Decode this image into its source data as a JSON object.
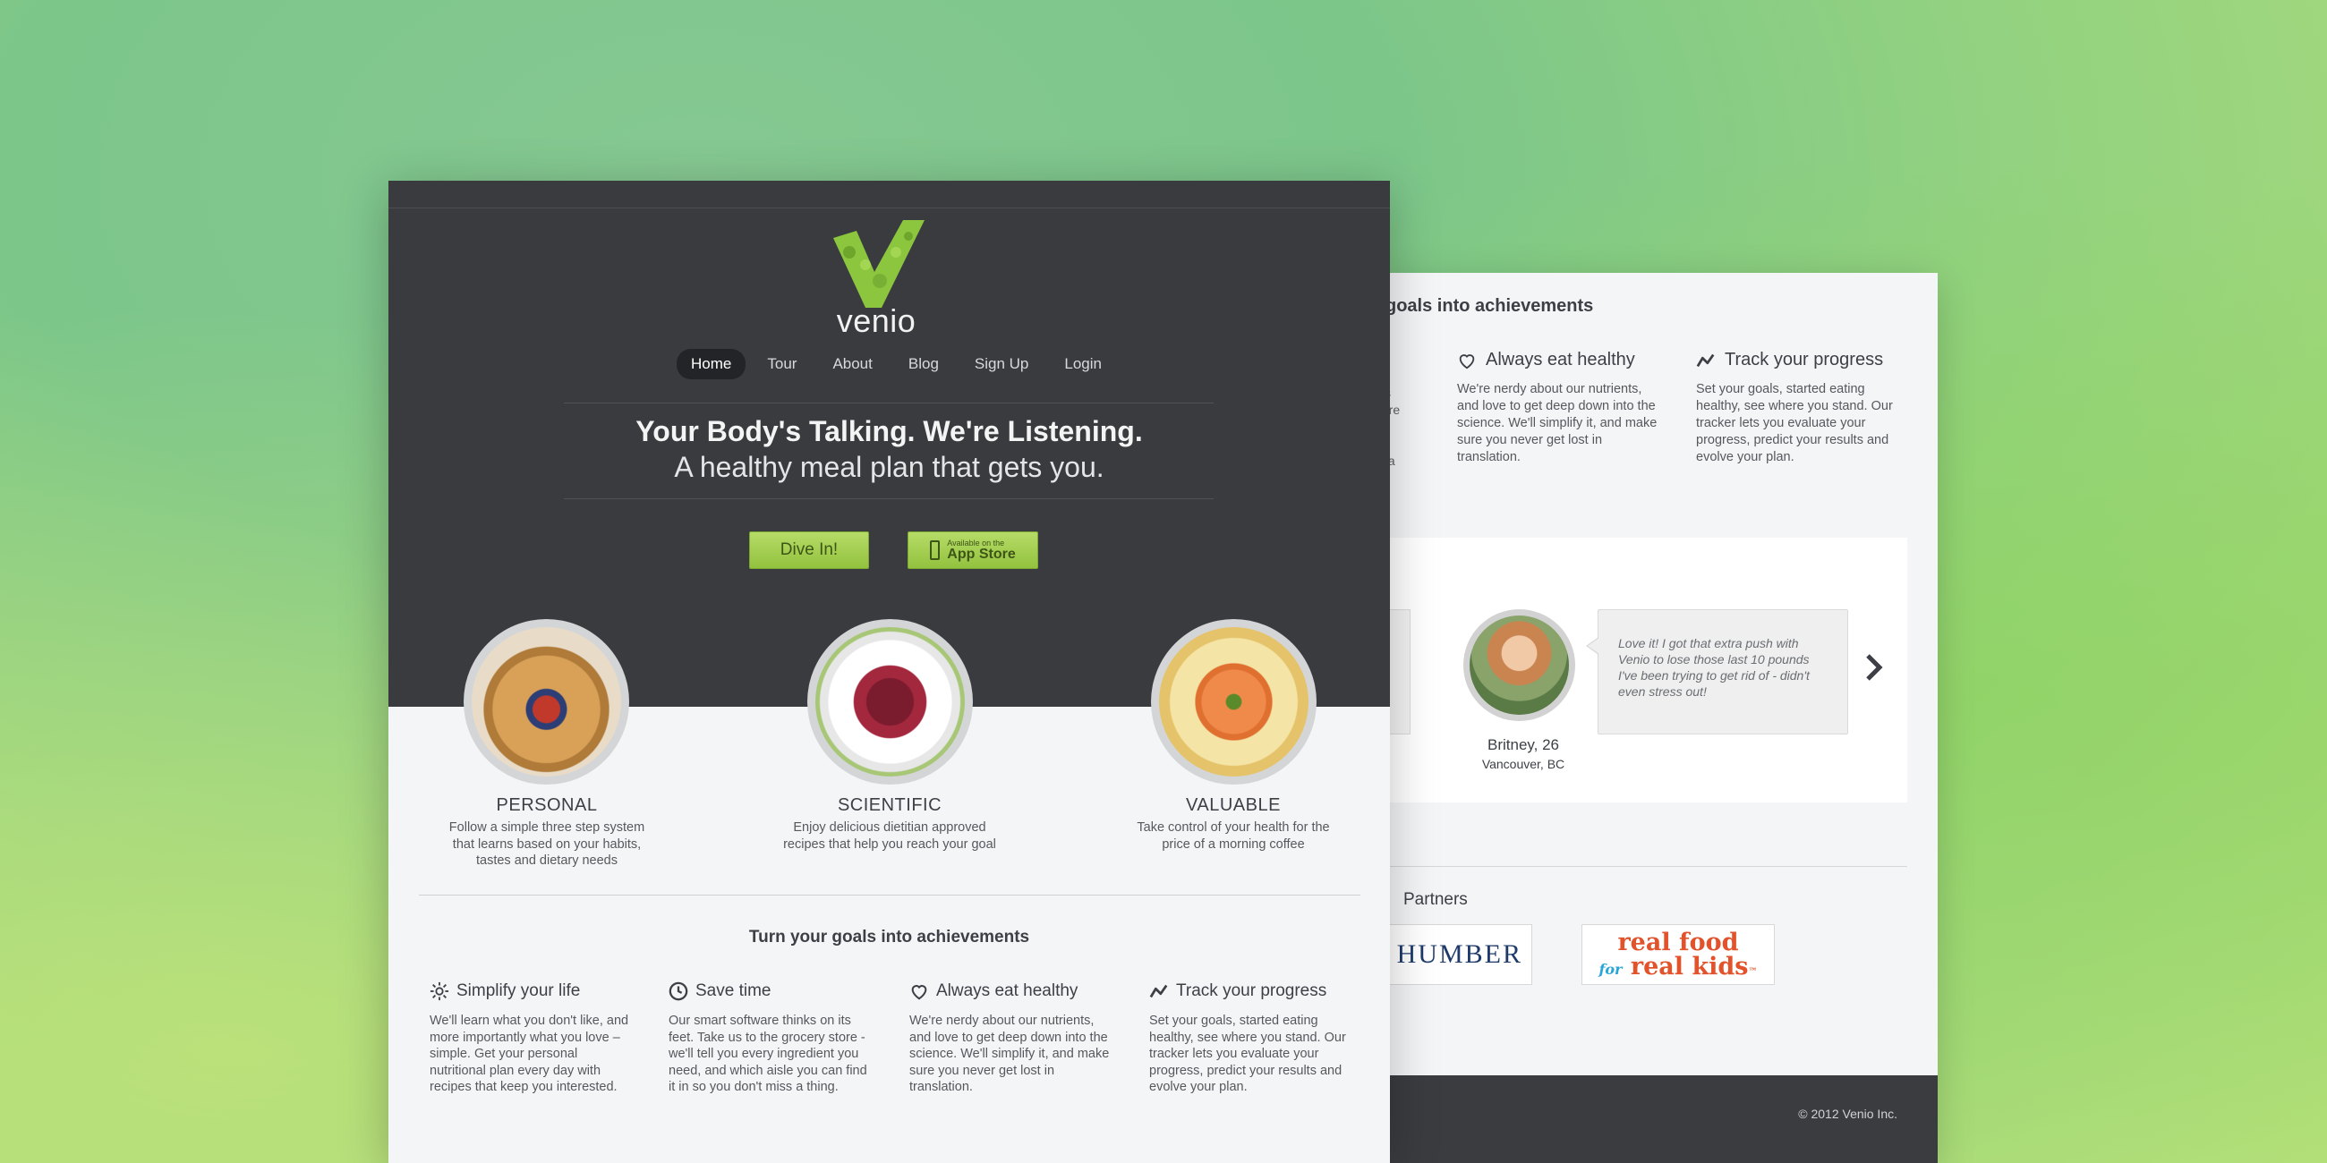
{
  "brand": {
    "name": "venio",
    "accent": "#8cc63f",
    "dark": "#3a3b3f"
  },
  "nav": {
    "items": [
      {
        "label": "Home",
        "active": true
      },
      {
        "label": "Tour"
      },
      {
        "label": "About"
      },
      {
        "label": "Blog"
      },
      {
        "label": "Sign Up"
      },
      {
        "label": "Login"
      }
    ]
  },
  "hero": {
    "headline": "Your Body's Talking. We're Listening.",
    "subhead": "A healthy meal plan that gets you.",
    "dive_button": "Dive In!",
    "appstore_small": "Available on the",
    "appstore_big": "App Store"
  },
  "features": [
    {
      "title": "PERSONAL",
      "desc": "Follow a simple three step system that learns based on your habits, tastes and dietary needs",
      "image": "pancake-berries"
    },
    {
      "title": "SCIENTIFIC",
      "desc": "Enjoy delicious dietitian approved recipes that help you reach your goal",
      "image": "beet-salad"
    },
    {
      "title": "VALUABLE",
      "desc": "Take control of your health for the price of a morning coffee",
      "image": "salmon-plate"
    }
  ],
  "goals": {
    "heading": "Turn your goals into achievements",
    "items": [
      {
        "title": "Simplify your life",
        "icon": "sun-icon",
        "desc": "We'll learn what you don't like, and more importantly what you love – simple. Get your personal nutritional plan every day with recipes that keep you interested."
      },
      {
        "title": "Save time",
        "icon": "clock-icon",
        "desc": "Our smart software thinks on its feet. Take us to the grocery store - we'll tell you every ingredient you need, and which aisle you can find it in so you don't miss a thing."
      },
      {
        "title": "Always eat healthy",
        "icon": "heart-icon",
        "desc": "We're nerdy about our nutrients, and love to get deep down into the science. We'll simplify it, and make sure you never get lost in translation."
      },
      {
        "title": "Track your progress",
        "icon": "trend-icon",
        "desc": "Set your goals, started eating healthy, see where you stand. Our tracker lets you evaluate your progress, predict your results and evolve your plan."
      }
    ]
  },
  "back": {
    "goals_heading_clipped": "goals into achievements",
    "clipped_text": "its\ntore\nnt\nu\ns a",
    "testimonial": {
      "quote": "Love it! I got that extra push with Venio to lose those last 10 pounds I've been trying to get rid of - didn't even stress out!",
      "name": "Britney, 26",
      "location": "Vancouver, BC"
    },
    "partners_title": "Partners",
    "partner_humber": "HUMBER",
    "partner_realfood_1": "real food",
    "partner_realfood_for": "for",
    "partner_realfood_2": "real kids",
    "partner_realfood_tm": "™",
    "copyright": "© 2012 Venio Inc."
  }
}
